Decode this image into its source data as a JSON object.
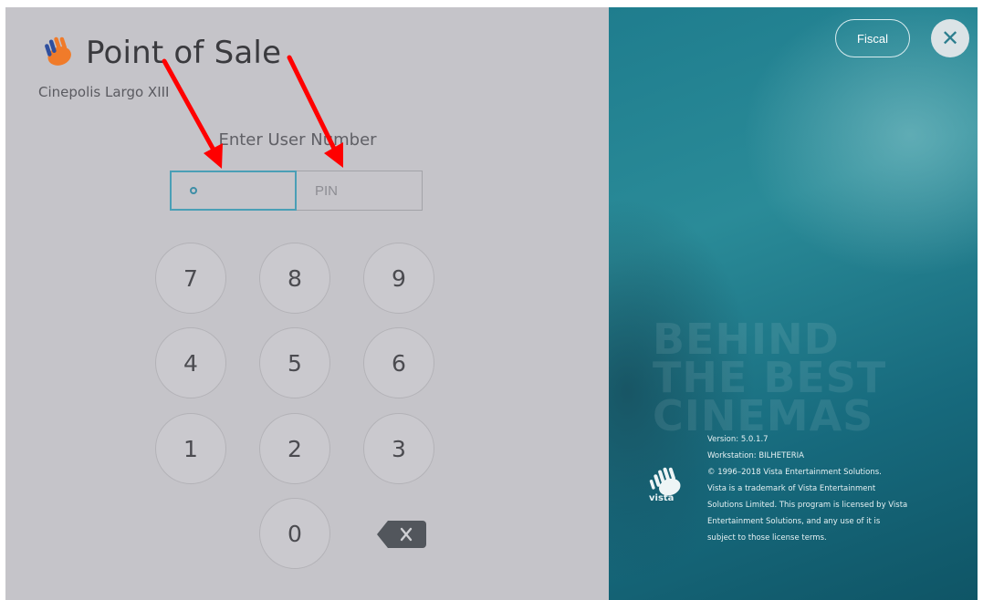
{
  "header": {
    "title": "Point of Sale",
    "site_name": "Cinepolis Largo XIII"
  },
  "login": {
    "prompt": "Enter User Number",
    "user_number_placeholder": "",
    "pin_placeholder": "PIN",
    "focus_color": "#4a9fb6"
  },
  "keypad": {
    "keys": [
      "7",
      "8",
      "9",
      "4",
      "5",
      "6",
      "1",
      "2",
      "3",
      "0"
    ],
    "backspace_icon": "backspace-icon"
  },
  "right_panel": {
    "fiscal_label": "Fiscal",
    "close_icon": "✕",
    "tagline": [
      "BEHIND",
      "THE BEST",
      "CINEMAS"
    ],
    "logo_text": "vista",
    "version": "Version: 5.0.1.7",
    "workstation": "Workstation: BILHETERIA",
    "copyright": [
      "© 1996–2018 Vista Entertainment Solutions.",
      "Vista is a trademark of Vista Entertainment",
      "Solutions Limited. This program is licensed by Vista",
      "Entertainment Solutions, and any use of it is",
      "subject to those license terms."
    ],
    "accent_color": "#1f7d8e"
  },
  "annotation": {
    "arrow_color": "#ff0000"
  }
}
